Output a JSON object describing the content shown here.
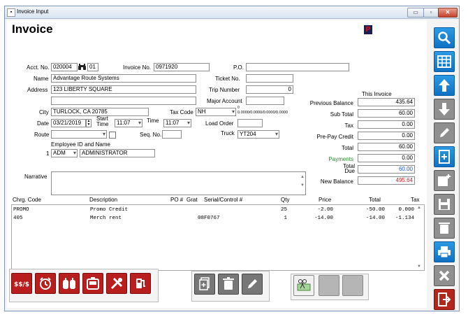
{
  "window": {
    "title": "Invoice Input",
    "minimize": "▭",
    "restore": "▫",
    "close": "✕"
  },
  "page": {
    "title": "Invoice",
    "p_badge": "P"
  },
  "header": {
    "acct_no_label": "Acct. No.",
    "acct_no": "020004",
    "acct_sub": "01",
    "invoice_no_label": "Invoice No.",
    "invoice_no": "0971920",
    "po_label": "P.O.",
    "po": "",
    "name_label": "Name",
    "name": "Advantage Route Systems",
    "ticket_no_label": "Ticket No.",
    "ticket_no": "",
    "address_label": "Address",
    "address1": "123 LIBERTY SQUARE",
    "address2": "",
    "trip_number_label": "Trip Number",
    "trip_number": "0",
    "major_account_label": "Major Account",
    "major_account": "",
    "city_label": "City",
    "city": "TURLOCK, CA  20785",
    "tax_code_label": "Tax Code",
    "tax_code": "NH",
    "tax_rates": "0.0000/0.0000/0.0000/0.0000",
    "date_label": "Date",
    "date": "03/21/2019",
    "start_time_label": "Start Time",
    "start_time": "11:07",
    "time_label": "Time",
    "time": "11:07",
    "load_order_label": "Load Order",
    "load_order": "",
    "route_label": "Route",
    "route": "",
    "seq_no_label": "Seq. No.",
    "seq_no": "",
    "truck_label": "Truck",
    "truck": "YT204",
    "employee_label": "Employee ID and Name",
    "employee_index": "1",
    "employee_id": "ADM",
    "employee_name": "ADMINISTRATOR",
    "narrative_label": "Narrative",
    "narrative": ""
  },
  "totals": {
    "this_invoice_label": "This Invoice",
    "previous_balance_label": "Previous Balance",
    "previous_balance": "435.64",
    "sub_total_label": "Sub Total",
    "sub_total": "60.00",
    "tax_label": "Tax",
    "tax": "0.00",
    "prepay_credit_label": "Pre-Pay Credit",
    "prepay_credit": "0.00",
    "total_label": "Total",
    "total": "60.00",
    "payments_label": "Payments",
    "payments": "0.00",
    "total_due_label": "Total Due",
    "total_due": "60.00",
    "new_balance_label": "New Balance",
    "new_balance": "495.64"
  },
  "grid": {
    "columns": [
      "Chrg. Code",
      "Description",
      "PO #",
      "Grat",
      "Serial/Control #",
      "Qty",
      "Price",
      "Total",
      "Tax"
    ],
    "rows": [
      {
        "code": "PROMO",
        "description": "Promo Credit",
        "po": "",
        "grat": "",
        "serial": "",
        "qty": "25",
        "price": "-2.00",
        "total": "-50.00",
        "tax": "0.000"
      },
      {
        "code": "405",
        "description": "Merch rent",
        "po": "",
        "grat": "",
        "serial": "08F0767",
        "qty": "1",
        "price": "-14.00",
        "total": "-14.00",
        "tax": "-1.134"
      }
    ]
  },
  "toolbar_icons": [
    "money-icon",
    "alarm-clock-icon",
    "tanks-icon",
    "register-icon",
    "tools-icon",
    "pump-icon",
    "copy-doc-icon",
    "trash-icon",
    "pencil-icon",
    "scissors-check-icon"
  ],
  "sidebar_icons": [
    "search-icon",
    "grid-icon",
    "arrow-up-icon",
    "arrow-down-icon",
    "pencil-icon",
    "add-document-icon",
    "add-card-icon",
    "save-icon",
    "trash-icon",
    "print-icon",
    "close-icon",
    "exit-icon"
  ],
  "colors": {
    "sidebar_blue": "#1a82d2",
    "toolbar_red": "#b91e1e",
    "new_balance": "#d42020",
    "payments": "#2a8a2a",
    "total_due": "#2255cc"
  }
}
